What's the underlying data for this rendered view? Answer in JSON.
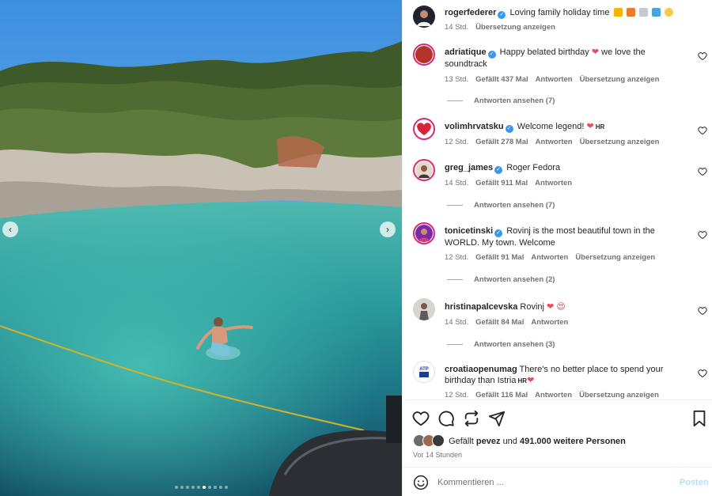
{
  "post": {
    "author": "rogerfederer",
    "caption": "Loving family holiday time",
    "time": "14 Std.",
    "translate": "Übersetzung anzeigen"
  },
  "comments": [
    {
      "user": "adriatique",
      "text_a": "Happy belated birthday",
      "text_b": "we love the soundtrack",
      "time": "13 Std.",
      "likes": "Gefällt 437 Mal",
      "reply": "Antworten",
      "translate": "Übersetzung anzeigen",
      "replies": "Antworten ansehen (7)"
    },
    {
      "user": "volimhrvatsku",
      "text_a": "Welcome legend!",
      "flag": "HR",
      "time": "12 Std.",
      "likes": "Gefällt 278 Mal",
      "reply": "Antworten",
      "translate": "Übersetzung anzeigen"
    },
    {
      "user": "greg_james",
      "text_a": "Roger Fedora",
      "time": "14 Std.",
      "likes": "Gefällt 911 Mal",
      "reply": "Antworten",
      "replies": "Antworten ansehen (7)"
    },
    {
      "user": "tonicetinski",
      "text_a": "Rovinj is the most beautiful town in the WORLD. My town. Welcome",
      "time": "12 Std.",
      "likes": "Gefällt 91 Mal",
      "reply": "Antworten",
      "translate": "Übersetzung anzeigen",
      "replies": "Antworten ansehen (2)"
    },
    {
      "user": "hristinapalcevska",
      "text_a": "Rovinj",
      "time": "14 Std.",
      "likes": "Gefällt 84 Mal",
      "reply": "Antworten",
      "replies": "Antworten ansehen (3)"
    },
    {
      "user": "croatiaopenumag",
      "text_a": "There's no better place to spend your birthday than Istria",
      "flag": "HR",
      "time": "12 Std.",
      "likes": "Gefällt 116 Mal",
      "reply": "Antworten",
      "translate": "Übersetzung anzeigen"
    }
  ],
  "footer": {
    "likes_prefix": "Gefällt",
    "likes_user": "pevez",
    "likes_mid": "und",
    "likes_count": "491.000 weitere Personen",
    "time_ago": "Vor 14 Stunden",
    "comment_placeholder": "Kommentieren ...",
    "post_label": "Posten"
  },
  "carousel": {
    "slides": 10,
    "active_index": 5
  },
  "icons": {
    "like": "heart-icon",
    "comment": "comment-icon",
    "share": "share-icon",
    "send": "send-icon",
    "save": "bookmark-icon",
    "emoji": "emoji-icon"
  },
  "colors": {
    "verified": "#3897f0",
    "heart": "#ed4956",
    "story_ring": "#d62976",
    "post_disabled": "#b2dffc"
  }
}
